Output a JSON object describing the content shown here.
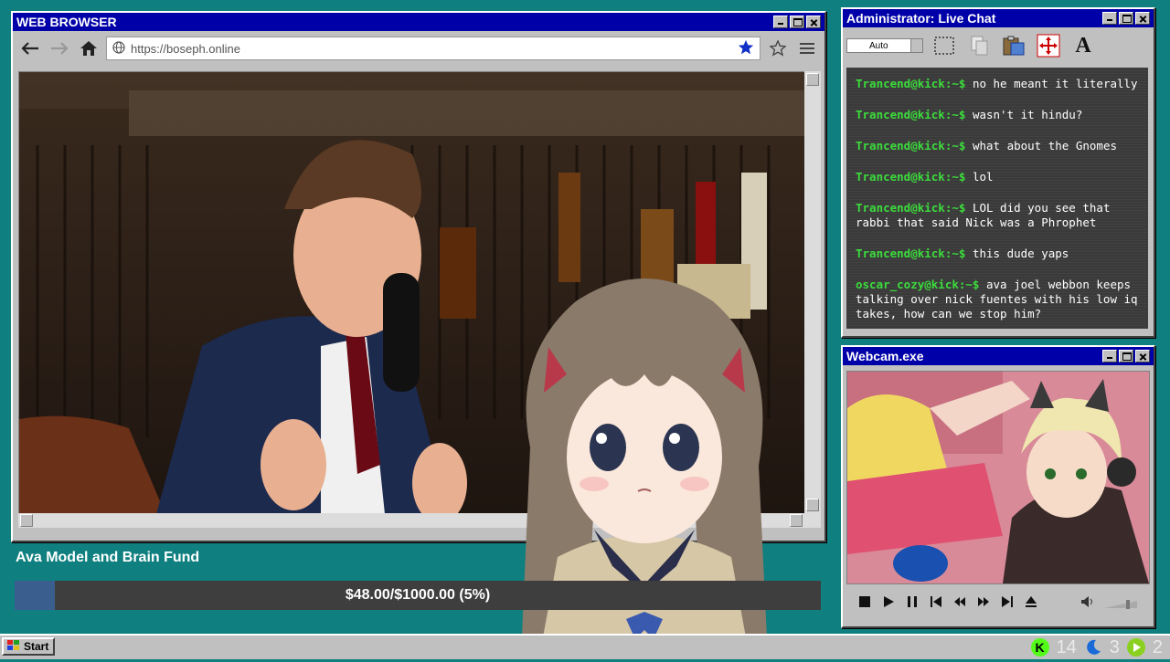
{
  "browser": {
    "title": "WEB BROWSER",
    "url": "https://boseph.online"
  },
  "chat": {
    "title": "Administrator: Live Chat",
    "mode": "Auto",
    "messages": [
      {
        "user": "Trancend@kick:~$",
        "text": "no he meant it literally"
      },
      {
        "user": "Trancend@kick:~$",
        "text": "wasn't it hindu?"
      },
      {
        "user": "Trancend@kick:~$",
        "text": "what about the Gnomes"
      },
      {
        "user": "Trancend@kick:~$",
        "text": "lol"
      },
      {
        "user": "Trancend@kick:~$",
        "text": "LOL did you see that rabbi that said Nick was a Phrophet"
      },
      {
        "user": "Trancend@kick:~$",
        "text": "this dude yaps"
      },
      {
        "user": "oscar_cozy@kick:~$",
        "text": "ava joel webbon keeps talking over nick fuentes with his low iq takes, how can we stop him?"
      }
    ]
  },
  "webcam": {
    "title": "Webcam.exe"
  },
  "fund": {
    "title": "Ava Model and Brain Fund",
    "progress_text": "$48.00/$1000.00 (5%)",
    "progress_fraction": 0.05
  },
  "taskbar": {
    "start_label": "Start",
    "tray": {
      "kick_count": "14",
      "moon_count": "3",
      "play_count": "2"
    }
  },
  "colors": {
    "desktop": "#0f7f7f",
    "titlebar": "#0000a8",
    "username": "#3cdc3c",
    "fund_fill": "#3a5f8e"
  },
  "icons": [
    "back-arrow-icon",
    "forward-arrow-icon",
    "home-icon",
    "globe-icon",
    "star-filled-icon",
    "star-outline-icon",
    "hamburger-menu-icon",
    "marquee-select-icon",
    "copy-icon",
    "paste-icon",
    "move-icon",
    "font-icon",
    "stop-icon",
    "play-icon",
    "pause-icon",
    "skip-back-icon",
    "rewind-icon",
    "fast-forward-icon",
    "skip-forward-icon",
    "eject-icon",
    "volume-icon",
    "windows-logo-icon",
    "kick-icon",
    "moon-icon",
    "play-circle-icon"
  ]
}
